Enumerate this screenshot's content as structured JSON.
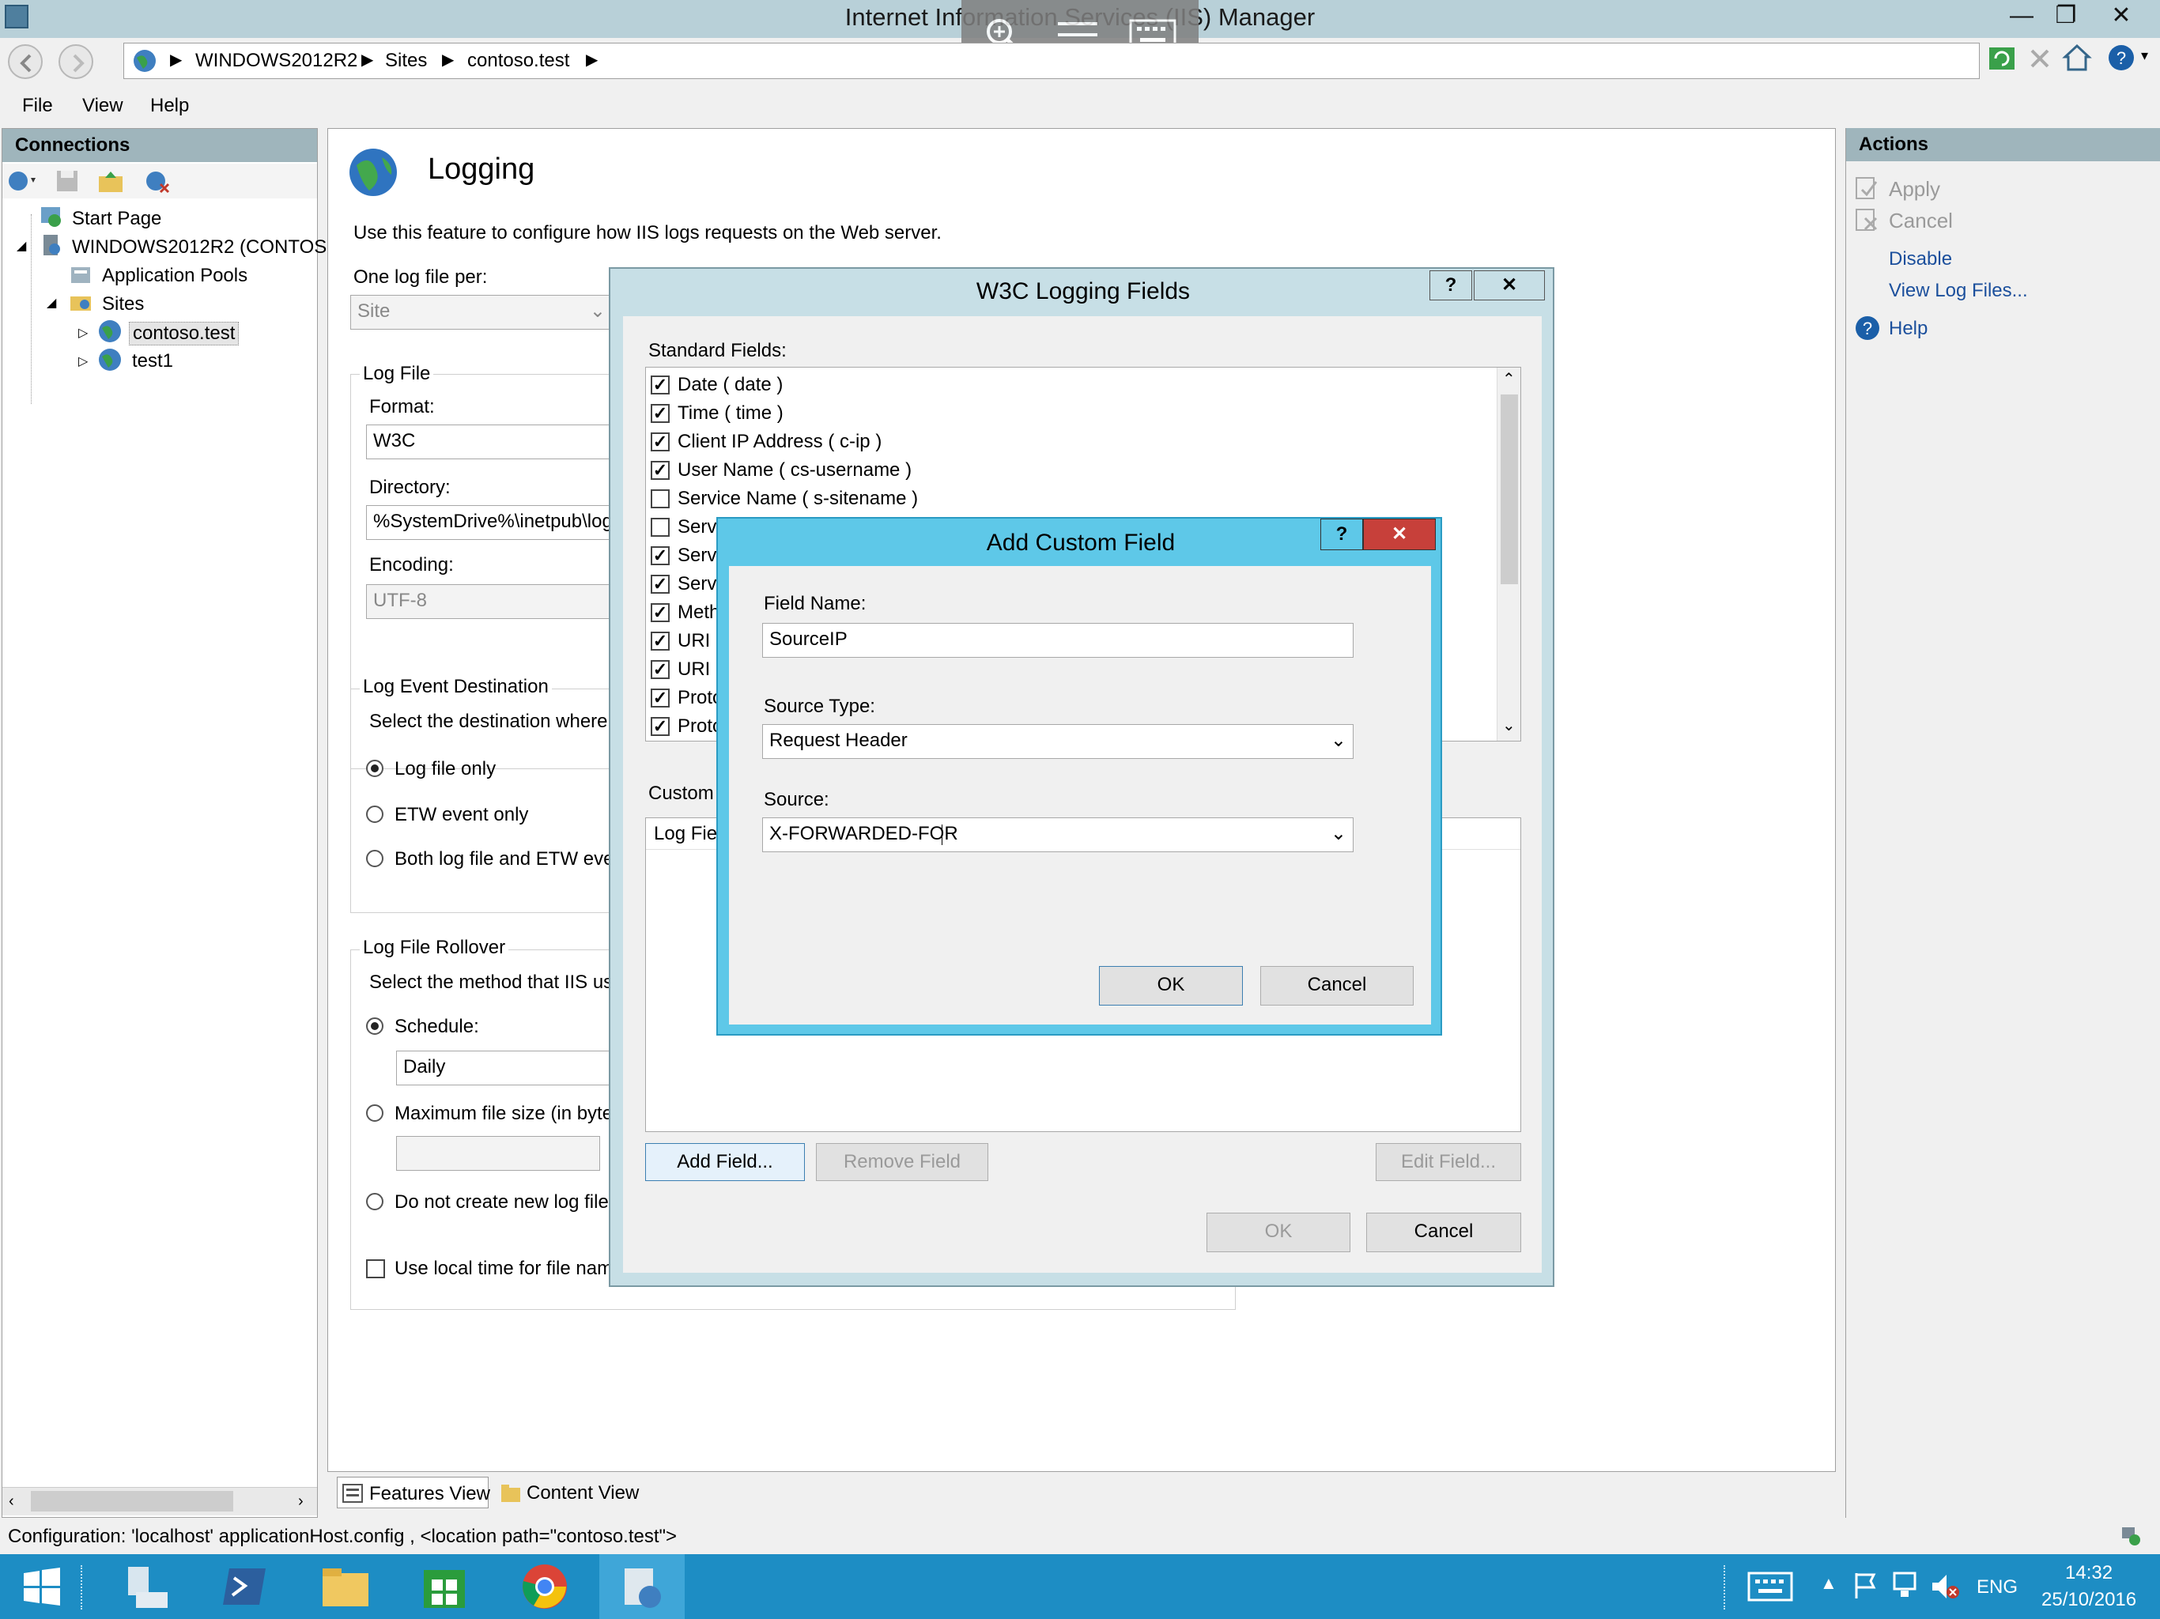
{
  "window": {
    "title": "Internet Information Services (IIS) Manager",
    "minimize": "—",
    "restore": "❐",
    "close": "✕"
  },
  "breadcrumb": [
    "WINDOWS2012R2",
    "Sites",
    "contoso.test"
  ],
  "menu": [
    "File",
    "View",
    "Help"
  ],
  "connections": {
    "title": "Connections",
    "tree": [
      "Start Page",
      "WINDOWS2012R2 (CONTOSO",
      "Application Pools",
      "Sites",
      "contoso.test",
      "test1"
    ]
  },
  "feature": {
    "title": "Logging",
    "description": "Use this feature to configure how IIS logs requests on the Web server.",
    "one_log_label": "One log file per:",
    "one_log_value": "Site",
    "log_file_group": "Log File",
    "format_label": "Format:",
    "format_value": "W3C",
    "directory_label": "Directory:",
    "directory_value": "%SystemDrive%\\inetpub\\log",
    "encoding_label": "Encoding:",
    "encoding_value": "UTF-8",
    "event_group": "Log Event Destination",
    "event_desc": "Select the destination where",
    "event_options": [
      "Log file only",
      "ETW event only",
      "Both log file and ETW eve"
    ],
    "rollover_group": "Log File Rollover",
    "rollover_desc": "Select the method that IIS us",
    "schedule_label": "Schedule:",
    "schedule_value": "Daily",
    "maxsize_label": "Maximum file size (in byte",
    "nonew_label": "Do not create new log file",
    "localtime_label": "Use local time for file nam"
  },
  "views": {
    "features": "Features View",
    "content": "Content View"
  },
  "actions": {
    "title": "Actions",
    "apply": "Apply",
    "cancel": "Cancel",
    "disable": "Disable",
    "view_logs": "View Log Files...",
    "help": "Help"
  },
  "w3c": {
    "title": "W3C Logging Fields",
    "help_btn": "?",
    "close_btn": "✕",
    "standard_label": "Standard Fields:",
    "fields": [
      {
        "label": "Date ( date )",
        "checked": true
      },
      {
        "label": "Time ( time )",
        "checked": true
      },
      {
        "label": "Client IP Address ( c-ip )",
        "checked": true
      },
      {
        "label": "User Name ( cs-username )",
        "checked": true
      },
      {
        "label": "Service Name ( s-sitename )",
        "checked": false
      },
      {
        "label": "Serve",
        "checked": false
      },
      {
        "label": "Serve",
        "checked": true
      },
      {
        "label": "Serve",
        "checked": true
      },
      {
        "label": "Meth",
        "checked": true
      },
      {
        "label": "URI S",
        "checked": true
      },
      {
        "label": "URI C",
        "checked": true
      },
      {
        "label": "Proto",
        "checked": true
      },
      {
        "label": "Proto",
        "checked": true
      }
    ],
    "custom_label": "Custom",
    "custom_col": "Log Fiel",
    "add_field": "Add Field...",
    "remove_field": "Remove Field",
    "edit_field": "Edit Field...",
    "ok": "OK",
    "cancel": "Cancel"
  },
  "acf": {
    "title": "Add Custom Field",
    "help_btn": "?",
    "close_btn": "✕",
    "field_name_label": "Field Name:",
    "field_name_value": "SourceIP",
    "source_type_label": "Source Type:",
    "source_type_value": "Request Header",
    "source_label": "Source:",
    "source_value": "X-FORWARDED-FOR",
    "ok": "OK",
    "cancel": "Cancel"
  },
  "status": "Configuration: 'localhost' applicationHost.config , <location path=\"contoso.test\">",
  "tray": {
    "lang": "ENG",
    "time": "14:32",
    "date": "25/10/2016"
  }
}
